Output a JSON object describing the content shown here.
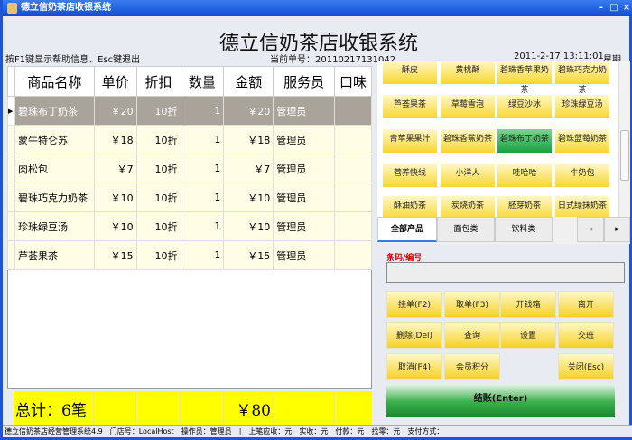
{
  "window": {
    "title": "德立信奶茶店收银系统",
    "controls": [
      "-",
      "□",
      "×"
    ]
  },
  "header": {
    "title": "德立信奶茶店收银系统",
    "help": "按F1键显示帮助信息、Esc键退出",
    "order_label": "当前单号：",
    "order_no": "20110217131042",
    "datetime": "2011-2-17 13:11:01",
    "weekday": "星期四"
  },
  "table": {
    "columns": [
      "商品名称",
      "单价",
      "折扣",
      "数量",
      "金额",
      "服务员",
      "口味"
    ],
    "rows": [
      [
        "碧珠布丁奶茶",
        "￥20",
        "10折",
        "1",
        "￥20",
        "管理员",
        ""
      ],
      [
        "蒙牛特仑苏",
        "￥18",
        "10折",
        "1",
        "￥18",
        "管理员",
        ""
      ],
      [
        "肉松包",
        "￥7",
        "10折",
        "1",
        "￥7",
        "管理员",
        ""
      ],
      [
        "碧珠巧克力奶茶",
        "￥10",
        "10折",
        "1",
        "￥10",
        "管理员",
        ""
      ],
      [
        "珍珠绿豆汤",
        "￥10",
        "10折",
        "1",
        "￥10",
        "管理员",
        ""
      ],
      [
        "芦荟果茶",
        "￥15",
        "10折",
        "1",
        "￥15",
        "管理员",
        ""
      ]
    ],
    "selected_row": 0
  },
  "total": {
    "label": "总计：6笔",
    "amount": "￥80"
  },
  "products": [
    "酥皮",
    "黄桃酥",
    "碧珠香苹果奶茶",
    "碧珠巧克力奶茶",
    "芦荟果茶",
    "草莓雪泡",
    "绿豆沙冰",
    "珍珠绿豆汤",
    "青苹果果汁",
    "碧珠香蕉奶茶",
    "碧珠布丁奶茶",
    "碧珠蓝莓奶茶",
    "营养快线",
    "小洋人",
    "哇哈哈",
    "牛奶包",
    "酥油奶茶",
    "炭烧奶茶",
    "胚芽奶茶",
    "日式绿抹奶茶"
  ],
  "active_product": "碧珠布丁奶茶",
  "tabs": [
    "全部产品",
    "面包类",
    "饮料类"
  ],
  "tab_nav": [
    "◂",
    "▸"
  ],
  "barcode": {
    "label": "条码/编号",
    "value": ""
  },
  "actions": [
    "挂单(F2)",
    "取单(F3)",
    "开钱箱",
    "离开",
    "删除(Del)",
    "查询",
    "设置",
    "交班",
    "取消(F4)",
    "会员积分",
    "",
    "关闭(Esc)"
  ],
  "checkout": "结账(Enter)",
  "status": [
    "德立信奶茶店经营管理系统4.9",
    "门店号：LocalHost",
    "操作员：管理员",
    "|",
    "上笔应收：元",
    "实收：元",
    "付款：元",
    "找零：元",
    "支付方式："
  ],
  "colors": {
    "accent_yellow": "#f7d630",
    "selected_green": "#16a040",
    "total_bg": "#ffff00"
  }
}
